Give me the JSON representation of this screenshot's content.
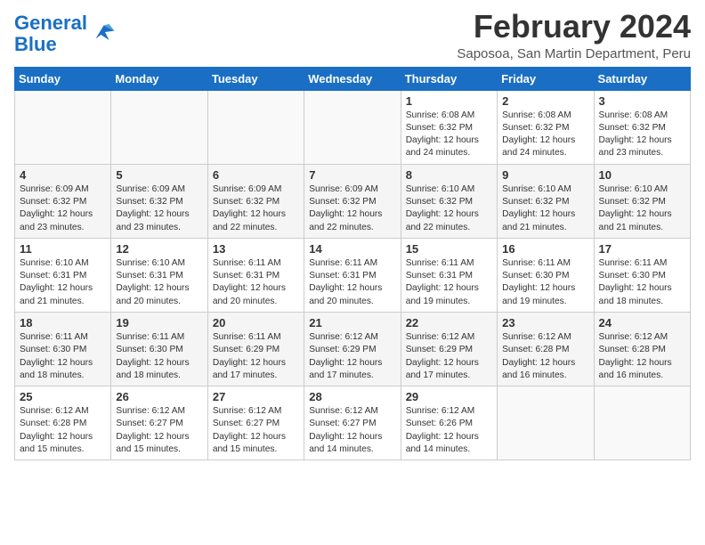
{
  "logo": {
    "line1": "General",
    "line2": "Blue"
  },
  "title": "February 2024",
  "subtitle": "Saposoa, San Martin Department, Peru",
  "days_of_week": [
    "Sunday",
    "Monday",
    "Tuesday",
    "Wednesday",
    "Thursday",
    "Friday",
    "Saturday"
  ],
  "weeks": [
    [
      {
        "day": "",
        "info": ""
      },
      {
        "day": "",
        "info": ""
      },
      {
        "day": "",
        "info": ""
      },
      {
        "day": "",
        "info": ""
      },
      {
        "day": "1",
        "info": "Sunrise: 6:08 AM\nSunset: 6:32 PM\nDaylight: 12 hours and 24 minutes."
      },
      {
        "day": "2",
        "info": "Sunrise: 6:08 AM\nSunset: 6:32 PM\nDaylight: 12 hours and 24 minutes."
      },
      {
        "day": "3",
        "info": "Sunrise: 6:08 AM\nSunset: 6:32 PM\nDaylight: 12 hours and 23 minutes."
      }
    ],
    [
      {
        "day": "4",
        "info": "Sunrise: 6:09 AM\nSunset: 6:32 PM\nDaylight: 12 hours and 23 minutes."
      },
      {
        "day": "5",
        "info": "Sunrise: 6:09 AM\nSunset: 6:32 PM\nDaylight: 12 hours and 23 minutes."
      },
      {
        "day": "6",
        "info": "Sunrise: 6:09 AM\nSunset: 6:32 PM\nDaylight: 12 hours and 22 minutes."
      },
      {
        "day": "7",
        "info": "Sunrise: 6:09 AM\nSunset: 6:32 PM\nDaylight: 12 hours and 22 minutes."
      },
      {
        "day": "8",
        "info": "Sunrise: 6:10 AM\nSunset: 6:32 PM\nDaylight: 12 hours and 22 minutes."
      },
      {
        "day": "9",
        "info": "Sunrise: 6:10 AM\nSunset: 6:32 PM\nDaylight: 12 hours and 21 minutes."
      },
      {
        "day": "10",
        "info": "Sunrise: 6:10 AM\nSunset: 6:32 PM\nDaylight: 12 hours and 21 minutes."
      }
    ],
    [
      {
        "day": "11",
        "info": "Sunrise: 6:10 AM\nSunset: 6:31 PM\nDaylight: 12 hours and 21 minutes."
      },
      {
        "day": "12",
        "info": "Sunrise: 6:10 AM\nSunset: 6:31 PM\nDaylight: 12 hours and 20 minutes."
      },
      {
        "day": "13",
        "info": "Sunrise: 6:11 AM\nSunset: 6:31 PM\nDaylight: 12 hours and 20 minutes."
      },
      {
        "day": "14",
        "info": "Sunrise: 6:11 AM\nSunset: 6:31 PM\nDaylight: 12 hours and 20 minutes."
      },
      {
        "day": "15",
        "info": "Sunrise: 6:11 AM\nSunset: 6:31 PM\nDaylight: 12 hours and 19 minutes."
      },
      {
        "day": "16",
        "info": "Sunrise: 6:11 AM\nSunset: 6:30 PM\nDaylight: 12 hours and 19 minutes."
      },
      {
        "day": "17",
        "info": "Sunrise: 6:11 AM\nSunset: 6:30 PM\nDaylight: 12 hours and 18 minutes."
      }
    ],
    [
      {
        "day": "18",
        "info": "Sunrise: 6:11 AM\nSunset: 6:30 PM\nDaylight: 12 hours and 18 minutes."
      },
      {
        "day": "19",
        "info": "Sunrise: 6:11 AM\nSunset: 6:30 PM\nDaylight: 12 hours and 18 minutes."
      },
      {
        "day": "20",
        "info": "Sunrise: 6:11 AM\nSunset: 6:29 PM\nDaylight: 12 hours and 17 minutes."
      },
      {
        "day": "21",
        "info": "Sunrise: 6:12 AM\nSunset: 6:29 PM\nDaylight: 12 hours and 17 minutes."
      },
      {
        "day": "22",
        "info": "Sunrise: 6:12 AM\nSunset: 6:29 PM\nDaylight: 12 hours and 17 minutes."
      },
      {
        "day": "23",
        "info": "Sunrise: 6:12 AM\nSunset: 6:28 PM\nDaylight: 12 hours and 16 minutes."
      },
      {
        "day": "24",
        "info": "Sunrise: 6:12 AM\nSunset: 6:28 PM\nDaylight: 12 hours and 16 minutes."
      }
    ],
    [
      {
        "day": "25",
        "info": "Sunrise: 6:12 AM\nSunset: 6:28 PM\nDaylight: 12 hours and 15 minutes."
      },
      {
        "day": "26",
        "info": "Sunrise: 6:12 AM\nSunset: 6:27 PM\nDaylight: 12 hours and 15 minutes."
      },
      {
        "day": "27",
        "info": "Sunrise: 6:12 AM\nSunset: 6:27 PM\nDaylight: 12 hours and 15 minutes."
      },
      {
        "day": "28",
        "info": "Sunrise: 6:12 AM\nSunset: 6:27 PM\nDaylight: 12 hours and 14 minutes."
      },
      {
        "day": "29",
        "info": "Sunrise: 6:12 AM\nSunset: 6:26 PM\nDaylight: 12 hours and 14 minutes."
      },
      {
        "day": "",
        "info": ""
      },
      {
        "day": "",
        "info": ""
      }
    ]
  ]
}
